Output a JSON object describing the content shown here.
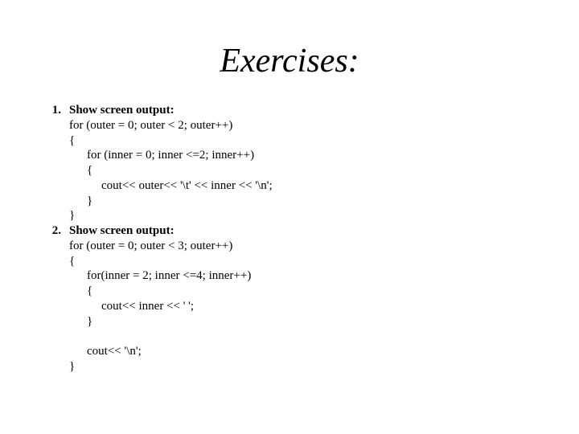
{
  "title": "Exercises:",
  "items": [
    {
      "num": "1.",
      "heading": "Show screen output:",
      "lines": [
        {
          "cls": "",
          "t": "for (outer = 0; outer < 2; outer++)"
        },
        {
          "cls": "",
          "t": "{"
        },
        {
          "cls": "ind1",
          "t": "for (inner = 0; inner <=2; inner++)"
        },
        {
          "cls": "ind1",
          "t": "{"
        },
        {
          "cls": "ind2",
          "t": "cout<< outer<< '\\t' << inner << '\\n';"
        },
        {
          "cls": "ind1",
          "t": "}"
        },
        {
          "cls": "",
          "t": "}"
        }
      ]
    },
    {
      "num": "2.",
      "heading": "Show screen output:",
      "lines": [
        {
          "cls": "",
          "t": "for (outer = 0; outer < 3; outer++)"
        },
        {
          "cls": "",
          "t": "{"
        },
        {
          "cls": "ind1",
          "t": "for(inner = 2; inner <=4; inner++)"
        },
        {
          "cls": "ind1",
          "t": "{"
        },
        {
          "cls": "ind2",
          "t": "cout<< inner << ' ';"
        },
        {
          "cls": "ind1",
          "t": "}"
        },
        {
          "cls": "ind1",
          "t": " "
        },
        {
          "cls": "ind1",
          "t": "cout<< '\\n';"
        },
        {
          "cls": "",
          "t": "}"
        }
      ]
    }
  ]
}
